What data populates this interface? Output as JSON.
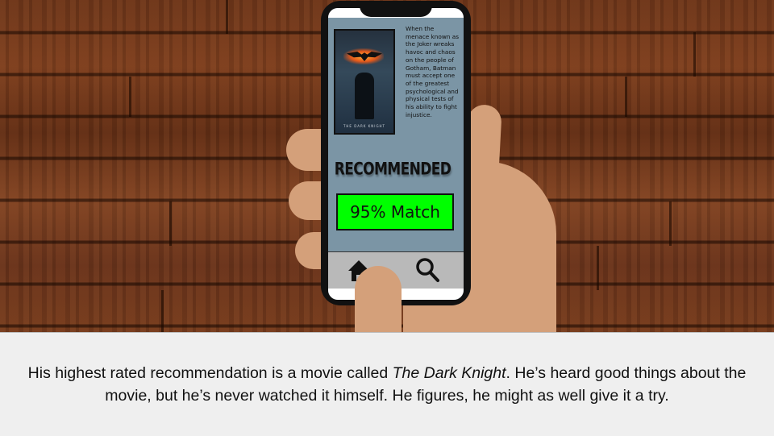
{
  "movie": {
    "poster_title": "THE DARK KNIGHT",
    "synopsis": "When the menace known as the Joker wreaks havoc and chaos on the people of Gotham, Batman must accept one of the greatest psychological and physical tests of his ability to fight injustice."
  },
  "recommendation": {
    "label": "RECOMMENDED",
    "match": "95% Match"
  },
  "navbar": {
    "home_icon": "home-icon",
    "search_icon": "search-icon"
  },
  "caption": {
    "before": "His highest rated recommendation is a movie called ",
    "title": "The Dark Knight",
    "after": ". He’s heard good things about the movie, but he’s never watched it himself. He figures, he might as well give it a try."
  },
  "colors": {
    "match_bg": "#00ff00",
    "screen_bg": "#7b95a5",
    "navbar_bg": "#b9b9b9",
    "skin": "#d4a07a",
    "caption_bg": "#efefef"
  }
}
